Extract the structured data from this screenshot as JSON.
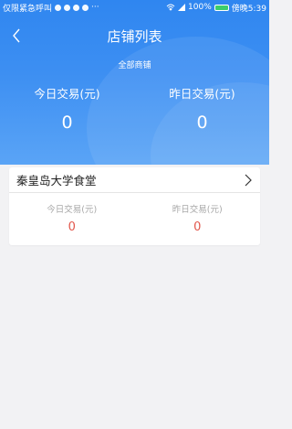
{
  "statusbar": {
    "left_text": "仅限紧急呼叫",
    "right_text": "100%",
    "time": "傍晚5:39"
  },
  "header": {
    "title": "店铺列表",
    "subtitle": "全部商铺",
    "today_label": "今日交易(元)",
    "today_value": "0",
    "yesterday_label": "昨日交易(元)",
    "yesterday_value": "0"
  },
  "shops": [
    {
      "name": "秦皇岛大学食堂",
      "today_label": "今日交易(元)",
      "today_value": "0",
      "yesterday_label": "昨日交易(元)",
      "yesterday_value": "0"
    }
  ],
  "colors": {
    "header_blue": "#3d8ff2",
    "value_red": "#e2574c",
    "background": "#f2f2f4"
  }
}
